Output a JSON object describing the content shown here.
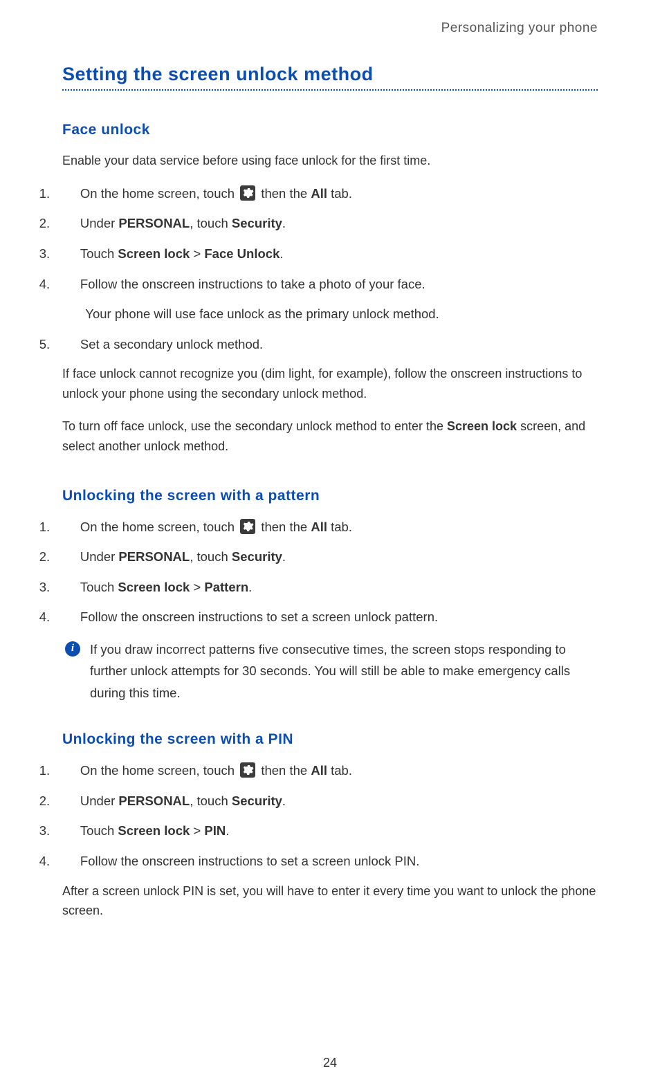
{
  "header": {
    "section_label": "Personalizing your phone"
  },
  "page_number": "24",
  "main_heading": "Setting the screen unlock method",
  "common": {
    "step_home_pre": "On the home screen, touch ",
    "step_home_post_pre": " then the ",
    "step_home_all": "All",
    "step_home_post_suf": " tab.",
    "step_personal_pre": "Under ",
    "step_personal_bold": "PERSONAL",
    "step_personal_mid": ", touch ",
    "step_personal_security": "Security",
    "step_personal_suf": ".",
    "touch_prefix": "Touch ",
    "screen_lock": "Screen lock",
    "gt": " > "
  },
  "sections": {
    "face": {
      "heading": "Face unlock",
      "intro": "Enable your data service before using face unlock for the first time.",
      "step3_target": "Face Unlock",
      "step4": "Follow the onscreen instructions to take a photo of your face.",
      "step4_sub": "Your phone will use face unlock as the primary unlock method.",
      "step5": "Set a secondary unlock method.",
      "note1": "If face unlock cannot recognize you (dim light, for example), follow the onscreen instructions to unlock your phone using the secondary unlock method.",
      "note2_pre": "To turn off face unlock, use the secondary unlock method to enter the ",
      "note2_bold": "Screen lock",
      "note2_suf": " screen, and select another unlock method."
    },
    "pattern": {
      "heading": "Unlocking the screen with a pattern",
      "step3_target": "Pattern",
      "step4": "Follow the onscreen instructions to set a screen unlock pattern.",
      "info": "If you draw incorrect patterns five consecutive times, the screen stops responding to further unlock attempts for 30 seconds. You will still be able to make emergency calls during this time."
    },
    "pin": {
      "heading": "Unlocking the screen with a PIN",
      "step3_target": "PIN",
      "step4": "Follow the onscreen instructions to set a screen unlock PIN.",
      "after": "After a screen unlock PIN is set, you will have to enter it every time you want to unlock the phone screen."
    }
  }
}
